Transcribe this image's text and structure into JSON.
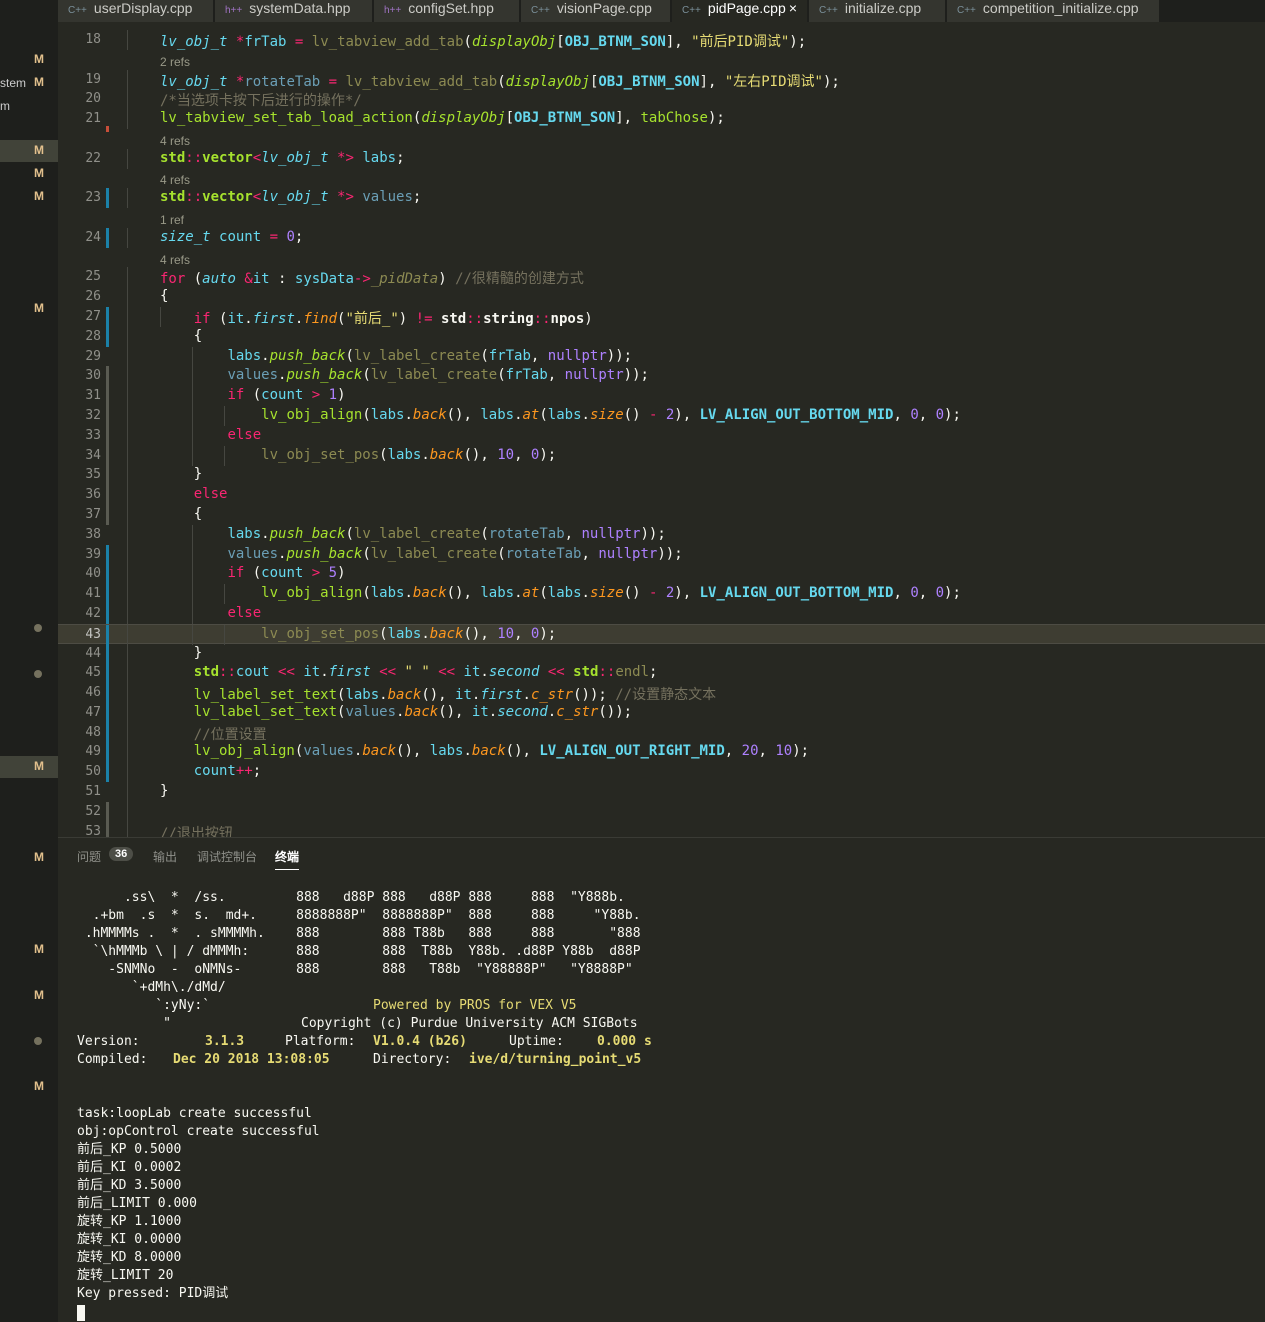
{
  "tabs": [
    {
      "label": "userDisplay.cpp",
      "icon": "cpp-file-icon"
    },
    {
      "label": "systemData.hpp",
      "icon": "hpp-file-icon"
    },
    {
      "label": "configSet.hpp",
      "icon": "hpp-file-icon"
    },
    {
      "label": "visionPage.cpp",
      "icon": "cpp-file-icon"
    },
    {
      "label": "pidPage.cpp",
      "icon": "cpp-file-icon",
      "active": true
    },
    {
      "label": "initialize.cpp",
      "icon": "cpp-file-icon"
    },
    {
      "label": "competition_initialize.cpp",
      "icon": "cpp-file-icon"
    }
  ],
  "icons": {
    "cpp": "C++",
    "hpp": "h++",
    "close": "×"
  },
  "sidebar": {
    "partial_names": [
      "stem",
      "m"
    ],
    "marker": "M"
  },
  "editor": {
    "refs": [
      "2 refs",
      "4 refs",
      "4 refs",
      "1 ref",
      "4 refs"
    ],
    "line_numbers": [
      "18",
      "19",
      "20",
      "21",
      "22",
      "23",
      "24",
      "25",
      "26",
      "27",
      "28",
      "29",
      "30",
      "31",
      "32",
      "33",
      "34",
      "35",
      "36",
      "37",
      "38",
      "39",
      "40",
      "41",
      "42",
      "43",
      "44",
      "45",
      "46",
      "47",
      "48",
      "49",
      "50",
      "51",
      "52",
      "53"
    ],
    "current_line": "43"
  },
  "panel": {
    "tabs": [
      "问题",
      "输出",
      "调试控制台",
      "终端"
    ],
    "active_tab": "终端",
    "problems_count": "36"
  },
  "terminal": {
    "banner": [
      "      .ss\\  *  /ss.         888   d88P 888   d88P 888     888  \"Y888b.",
      "  .+bm  .s  *  s.  md+.     8888888P\"  8888888P\"  888     888     \"Y88b.",
      " .hMMMMs .  *  . sMMMMh.    888        888 T88b   888     888       \"888",
      "  `\\hMMMb \\ | / dMMMh:      888        888  T88b  Y88b. .d88P Y88b  d88P",
      "    -SNMNo  -  oNMNs-       888        888   T88b  \"Y88888P\"   \"Y8888P\"",
      "       `+dMh\\./dMd/",
      "          `:yNy:`"
    ],
    "banner_dq": "\"",
    "powered": "Powered by PROS for VEX V5",
    "copyright": "Copyright (c) Purdue University ACM SIGBots",
    "version_label": "Version:",
    "version": "3.1.3",
    "platform_label": "Platform:",
    "platform": "V1.0.4 (b26)",
    "uptime_label": "Uptime:",
    "uptime": "0.000 s",
    "compiled_label": "Compiled:",
    "compiled": "Dec 20 2018 13:08:05",
    "directory_label": "Directory:",
    "directory": "ive/d/turning_point_v5",
    "log": [
      "task:loopLab create successful",
      "obj:opControl create successful",
      "前后_KP 0.5000",
      "前后_KI 0.0002",
      "前后_KD 3.5000",
      "前后_LIMIT 0.000",
      "旋转_KP 1.1000",
      "旋转_KI 0.0000",
      "旋转_KD 8.0000",
      "旋转_LIMIT 20",
      "Key pressed: PID调试"
    ]
  }
}
